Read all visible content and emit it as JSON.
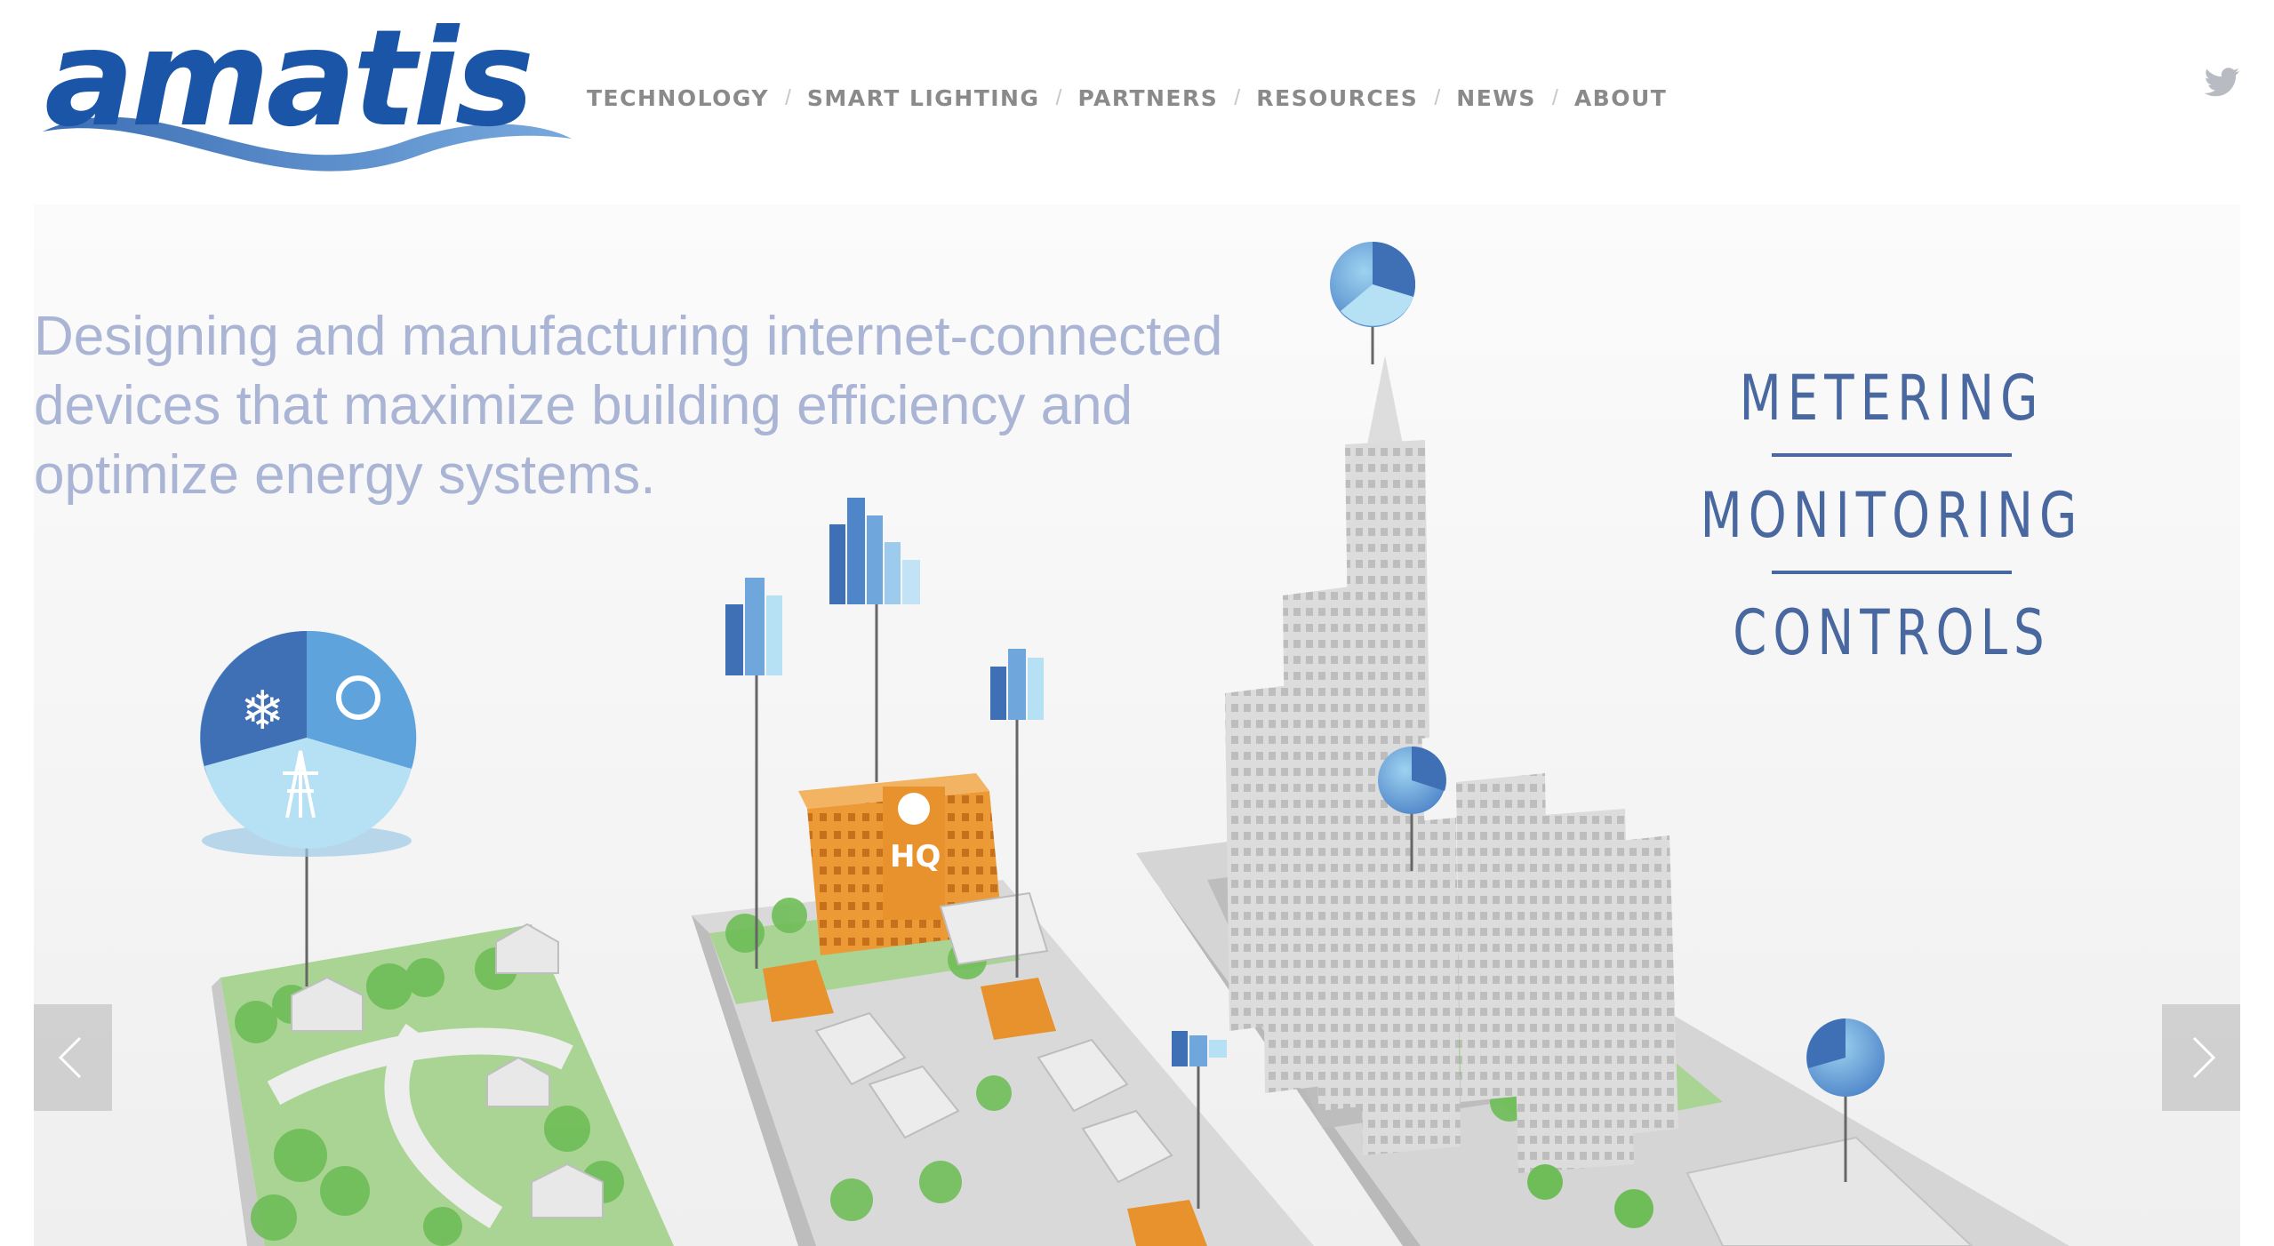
{
  "brand": {
    "logo_text": "amatis"
  },
  "nav": {
    "items": [
      "TECHNOLOGY",
      "SMART LIGHTING",
      "PARTNERS",
      "RESOURCES",
      "NEWS",
      "ABOUT"
    ],
    "separator": "/"
  },
  "social": {
    "twitter_icon": "twitter-icon"
  },
  "hero": {
    "tagline_lines": [
      "Designing and manufacturing internet-connected",
      "devices that maximize building efficiency and",
      "optimize energy systems."
    ],
    "features": [
      "METERING",
      "MONITORING",
      "CONTROLS"
    ],
    "hq_label": "HQ"
  },
  "slider": {
    "prev_icon": "chevron-left-icon",
    "next_icon": "chevron-right-icon"
  },
  "colors": {
    "brand_blue": "#1a55a8",
    "nav_gray": "#8a8a8a",
    "tagline": "#aab4d4",
    "feature_blue": "#4a68a0",
    "hq_orange": "#e8922e"
  }
}
